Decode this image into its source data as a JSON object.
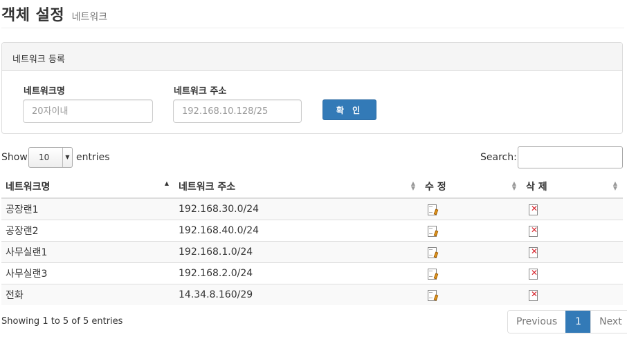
{
  "header": {
    "title": "객체 설정",
    "subtitle": "네트워크"
  },
  "panel": {
    "heading": "네트워크 등록",
    "name_label": "네트워크명",
    "name_placeholder": "20자이내",
    "addr_label": "네트워크 주소",
    "addr_placeholder": "192.168.10.128/25",
    "confirm_label": "확 인"
  },
  "table_controls": {
    "show_label": "Show",
    "page_length": "10",
    "entries_label": "entries",
    "search_label": "Search:"
  },
  "table": {
    "columns": [
      "네트워크명",
      "네트워크 주소",
      "수 정",
      "삭 제"
    ],
    "rows": [
      {
        "name": "공장랜1",
        "address": "192.168.30.0/24"
      },
      {
        "name": "공장랜2",
        "address": "192.168.40.0/24"
      },
      {
        "name": "사무실랜1",
        "address": "192.168.1.0/24"
      },
      {
        "name": "사무실랜3",
        "address": "192.168.2.0/24"
      },
      {
        "name": "전화",
        "address": "14.34.8.160/29"
      }
    ],
    "edit_icon": "edit-document-icon",
    "delete_icon": "delete-document-icon"
  },
  "footer": {
    "info": "Showing 1 to 5 of 5 entries",
    "prev_label": "Previous",
    "current_page": "1",
    "next_label": "Next"
  },
  "colors": {
    "primary": "#337ab7",
    "delete": "#d6232b",
    "edit": "#e39a1e"
  }
}
